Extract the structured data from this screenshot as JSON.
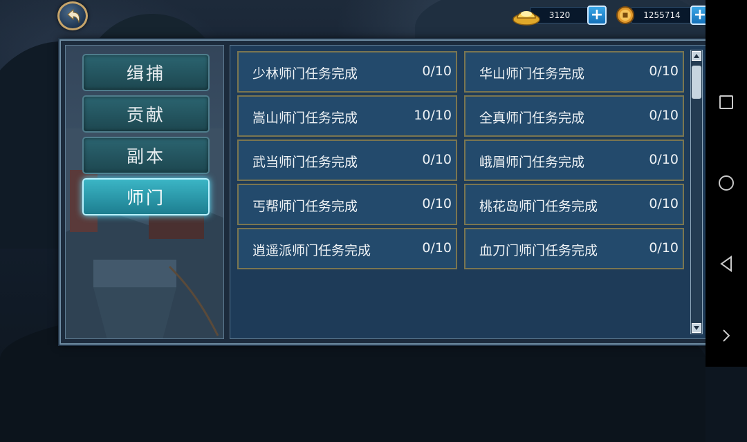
{
  "topbar": {
    "gold": {
      "icon": "gold-ingot-icon",
      "value": "3120"
    },
    "coins": {
      "icon": "copper-coin-icon",
      "value": "1255714"
    }
  },
  "tabs": [
    {
      "label": "缉捕",
      "active": false
    },
    {
      "label": "贡献",
      "active": false
    },
    {
      "label": "副本",
      "active": false
    },
    {
      "label": "师门",
      "active": true
    }
  ],
  "tasks": [
    {
      "name": "少林师门任务完成",
      "progress": "0/10"
    },
    {
      "name": "华山师门任务完成",
      "progress": "0/10"
    },
    {
      "name": "嵩山师门任务完成",
      "progress": "10/10"
    },
    {
      "name": "全真师门任务完成",
      "progress": "0/10"
    },
    {
      "name": "武当师门任务完成",
      "progress": "0/10"
    },
    {
      "name": "峨眉师门任务完成",
      "progress": "0/10"
    },
    {
      "name": "丐帮师门任务完成",
      "progress": "0/10"
    },
    {
      "name": "桃花岛师门任务完成",
      "progress": "0/10"
    },
    {
      "name": "逍遥派师门任务完成",
      "progress": "0/10"
    },
    {
      "name": "血刀门师门任务完成",
      "progress": "0/10"
    }
  ],
  "colors": {
    "active_tab": "#3bb5c5",
    "task_border": "#7b7650",
    "plus_button": "#1f8ad6"
  },
  "system_nav": [
    "recent-apps-icon",
    "home-icon",
    "back-icon",
    "expand-icon"
  ]
}
